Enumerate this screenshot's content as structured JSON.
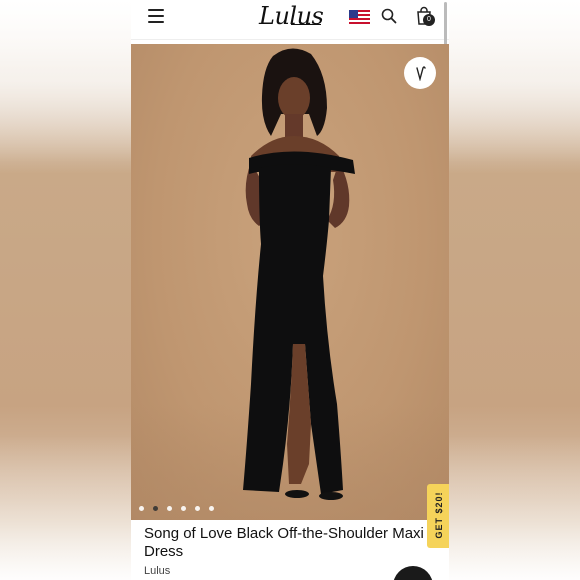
{
  "header": {
    "logo_text": "Lulus",
    "bag_count": "0",
    "menu_icon": "hamburger-icon",
    "search_icon": "search-icon",
    "bag_icon": "shopping-bag-icon",
    "flag_icon": "us-flag-icon"
  },
  "gallery": {
    "favorite_icon": "heart-icon",
    "dot_count": 6,
    "active_dot": 1
  },
  "promo": {
    "label": "GET $20!",
    "color": "#f5d35a"
  },
  "product": {
    "title": "Song of Love Black Off-the-Shoulder Maxi Dress",
    "brand": "Lulus"
  },
  "colors": {
    "backdrop": "#c4a07b",
    "dress": "#0e0e0f"
  }
}
